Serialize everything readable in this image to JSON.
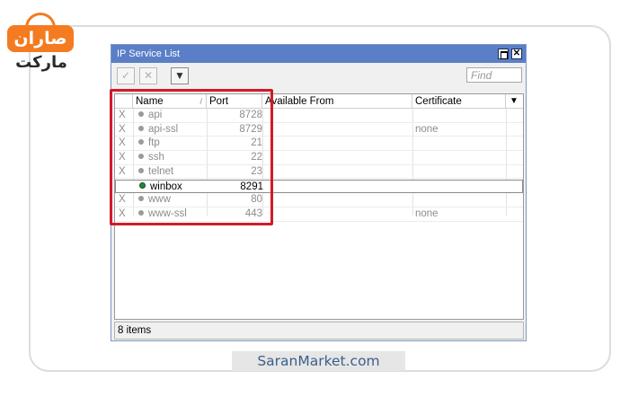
{
  "logo": {
    "line1": "صاران",
    "line2": "مارکت"
  },
  "window": {
    "title": "IP Service List",
    "close_glyph": "✕",
    "toolbar": {
      "enable_glyph": "✓",
      "disable_glyph": "✕",
      "filter_glyph": "▼",
      "find_placeholder": "Find"
    },
    "columns": {
      "name": "Name",
      "sort_glyph": "/",
      "port": "Port",
      "available_from": "Available From",
      "certificate": "Certificate",
      "menu_glyph": "▼"
    },
    "rows": [
      {
        "flag": "X",
        "name": "api",
        "port": "8728",
        "certificate": ""
      },
      {
        "flag": "X",
        "name": "api-ssl",
        "port": "8729",
        "certificate": "none"
      },
      {
        "flag": "X",
        "name": "ftp",
        "port": "21",
        "certificate": ""
      },
      {
        "flag": "X",
        "name": "ssh",
        "port": "22",
        "certificate": ""
      },
      {
        "flag": "X",
        "name": "telnet",
        "port": "23",
        "certificate": ""
      },
      {
        "flag": "",
        "name": "winbox",
        "port": "8291",
        "certificate": ""
      },
      {
        "flag": "X",
        "name": "www",
        "port": "80",
        "certificate": ""
      },
      {
        "flag": "X",
        "name": "www-ssl",
        "port": "443",
        "certificate": "none"
      }
    ],
    "status": "8 items"
  },
  "footer": {
    "text": "SaranMarket.com"
  },
  "colors": {
    "accent": "#d11a2a",
    "titlebar": "#5a7fc7",
    "logo": "#f47b20"
  }
}
